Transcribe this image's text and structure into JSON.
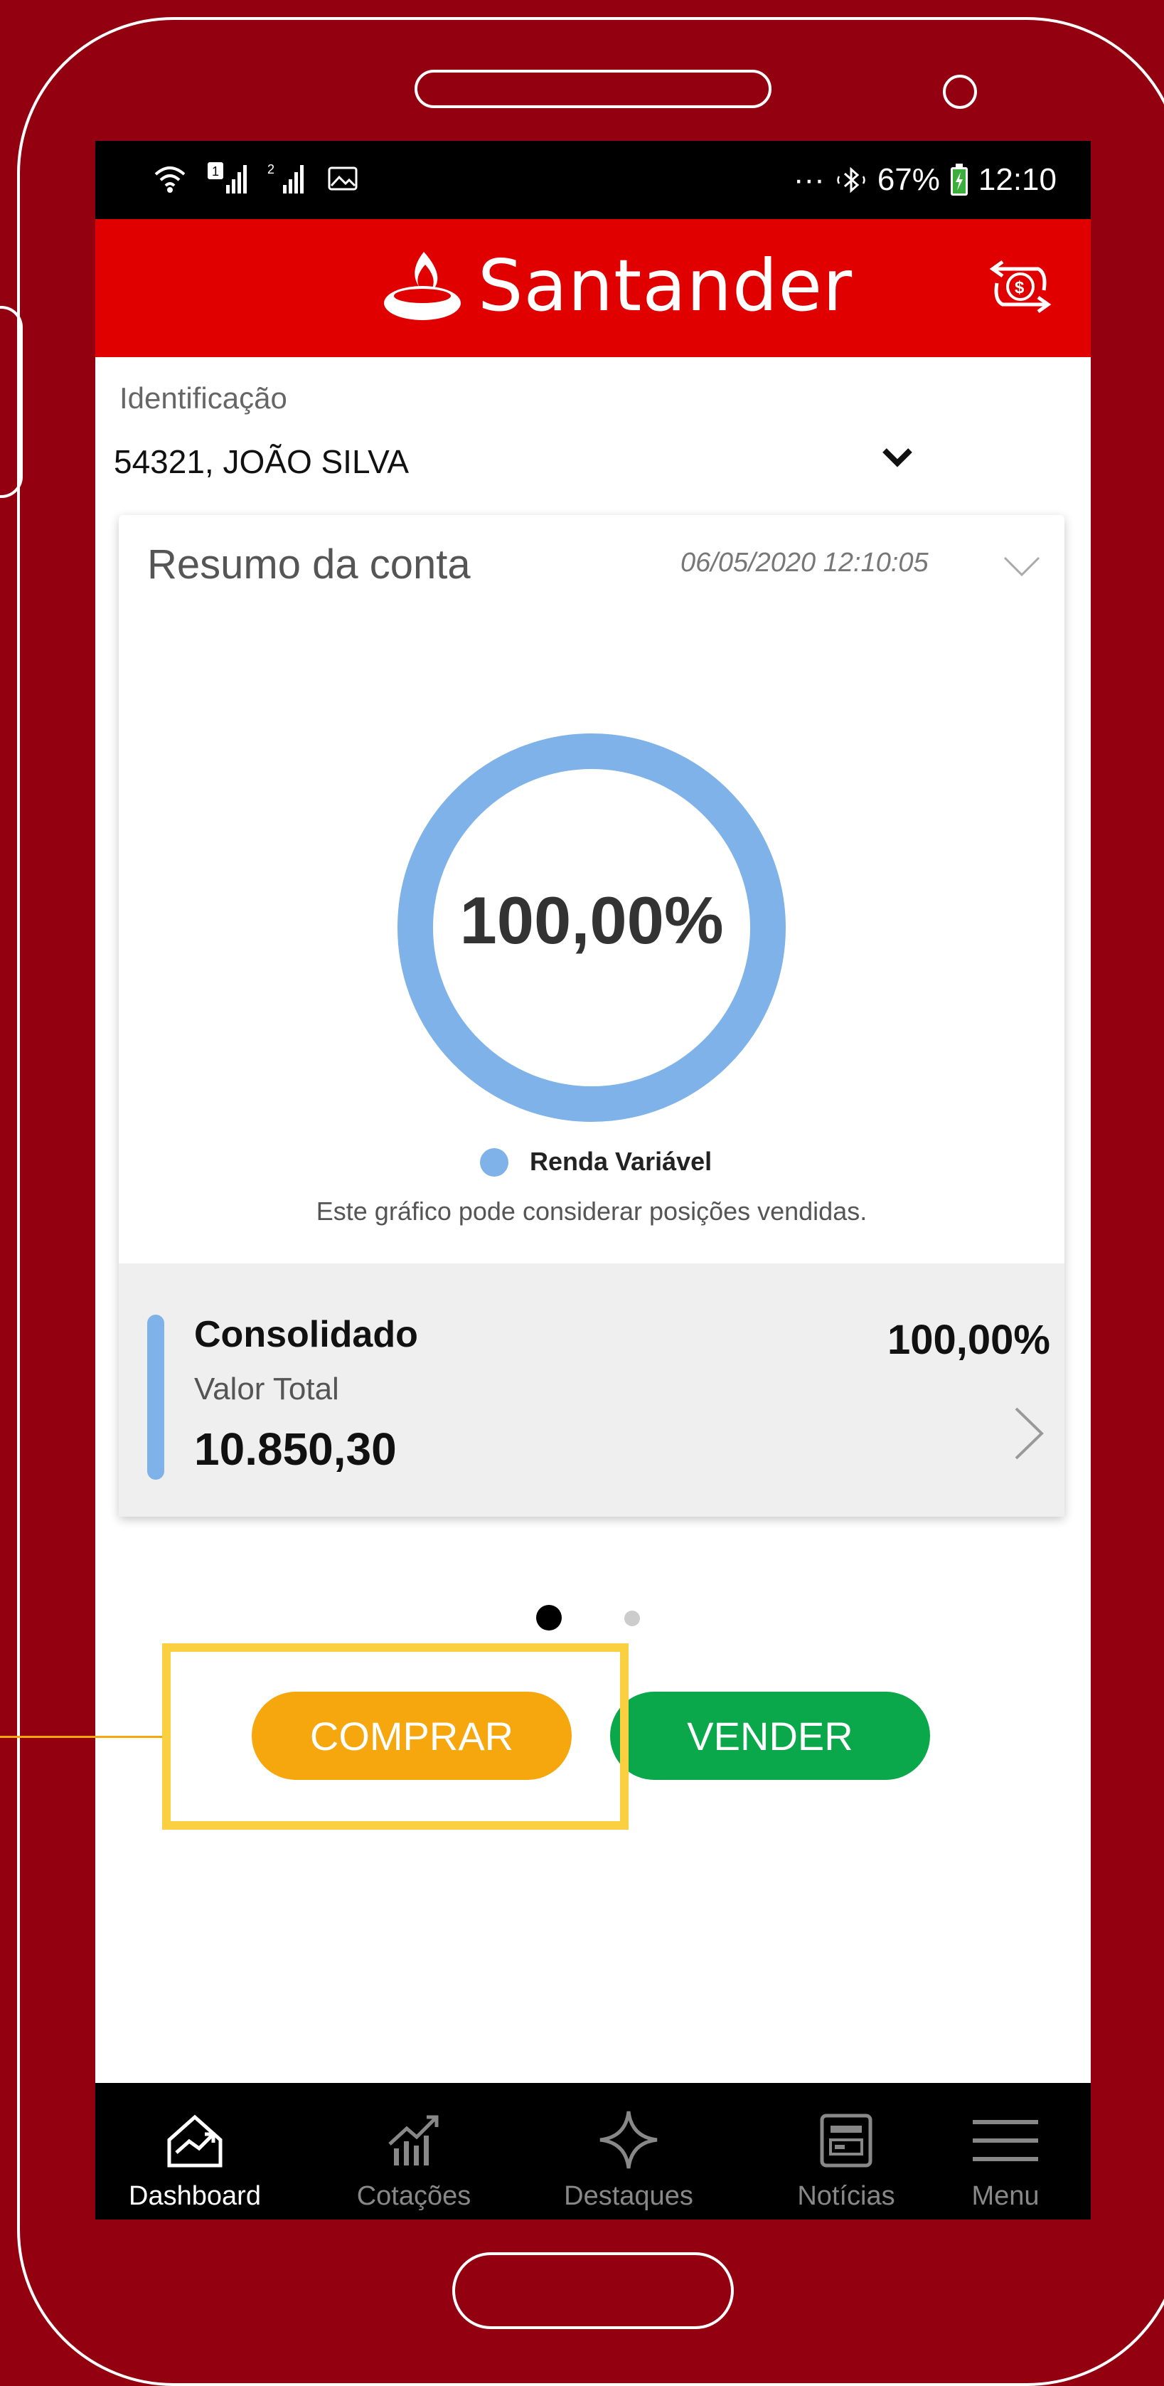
{
  "status_bar": {
    "left_icons": [
      "wifi-icon",
      "signal-sim1-icon",
      "signal-sim2-icon",
      "image-notification-icon"
    ],
    "more_indicator": "···",
    "battery": "67%",
    "time": "12:10"
  },
  "header": {
    "brand": "Santander",
    "switch_icon": "currency-exchange-icon"
  },
  "identification": {
    "label": "Identificação",
    "value": "54321, JOÃO SILVA"
  },
  "summary_card": {
    "title": "Resumo da conta",
    "timestamp": "06/05/2020 12:10:05",
    "center_text": "100,00%",
    "note": "Este gráfico pode considerar posições vendidas.",
    "consolidated": {
      "title": "Consolidado",
      "percent": "100,00%",
      "sub_label": "Valor Total",
      "value": "10.850,30"
    }
  },
  "chart_data": {
    "type": "pie",
    "categories": [
      "Renda Variável"
    ],
    "values": [
      100
    ],
    "title": "",
    "center_label": "100,00%",
    "colors": [
      "#7eb2e8"
    ],
    "legend_position": "bottom"
  },
  "pager": {
    "pages": 2,
    "current": 1
  },
  "actions": {
    "buy": "COMPRAR",
    "sell": "VENDER"
  },
  "bottom_nav": [
    {
      "label": "Dashboard",
      "icon": "dashboard-chart-icon",
      "active": true
    },
    {
      "label": "Cotações",
      "icon": "quotes-chart-icon",
      "active": false
    },
    {
      "label": "Destaques",
      "icon": "star-sparkle-icon",
      "active": false
    },
    {
      "label": "Notícias",
      "icon": "news-icon",
      "active": false
    },
    {
      "label": "Menu",
      "icon": "hamburger-menu-icon",
      "active": false
    }
  ],
  "colors": {
    "frame_bg": "#930010",
    "brand_red": "#e00000",
    "buy_button": "#f5a70d",
    "sell_button": "#0aa84a",
    "chart_series": "#7eb2e8",
    "highlight": "#fbd040"
  }
}
